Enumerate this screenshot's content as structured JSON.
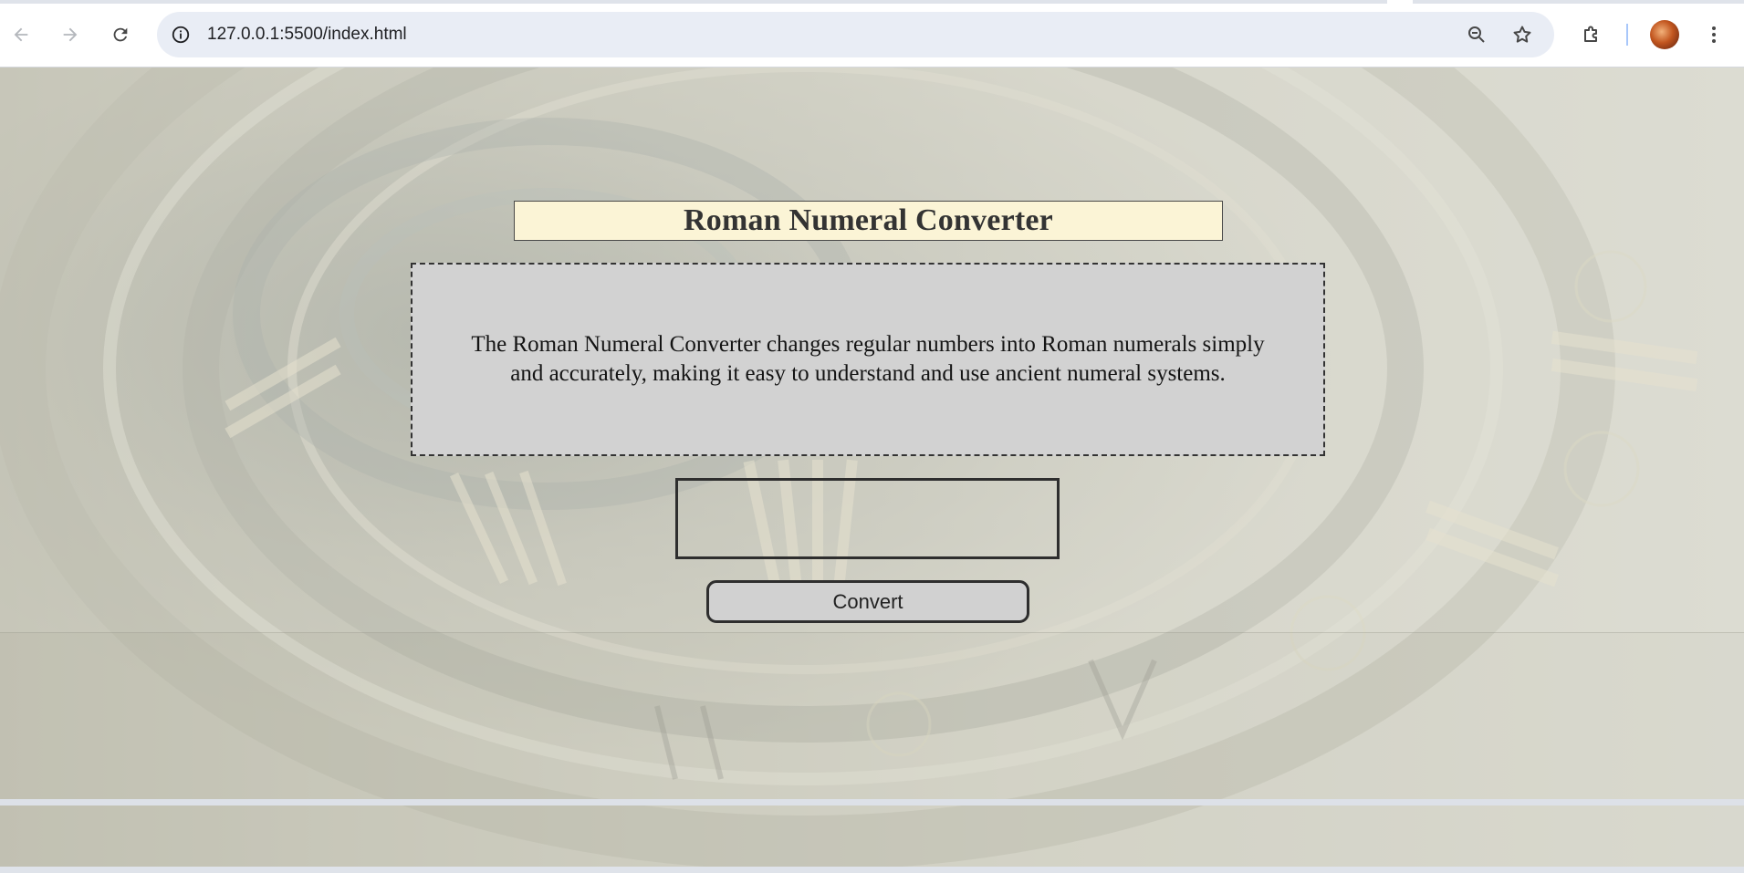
{
  "browser": {
    "url": "127.0.0.1:5500/index.html",
    "back_icon": "arrow-left-icon",
    "forward_icon": "arrow-right-icon",
    "reload_icon": "reload-icon",
    "site_info_icon": "info-icon",
    "zoom_icon": "zoom-icon",
    "bookmark_icon": "star-icon",
    "extensions_icon": "puzzle-icon",
    "menu_icon": "kebab-icon"
  },
  "app": {
    "title": "Roman Numeral Converter",
    "description": "The Roman Numeral Converter changes regular numbers into Roman numerals simply and accurately, making it easy to understand and use ancient numeral systems.",
    "input_value": "",
    "input_placeholder": "",
    "convert_label": "Convert"
  },
  "colors": {
    "title_bg": "#fbf4d6",
    "panel_bg": "#d2d2d2",
    "button_bg": "#d1d1d1",
    "border": "#2e2e2e"
  }
}
